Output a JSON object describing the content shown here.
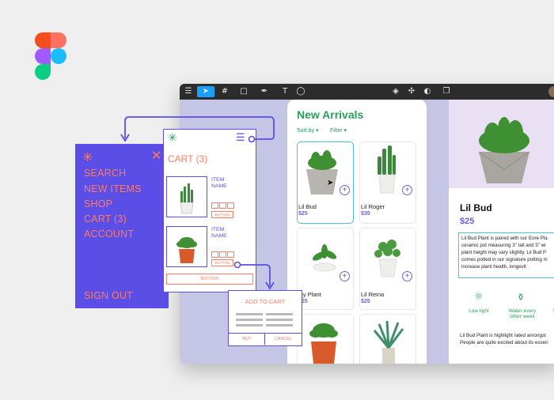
{
  "colors": {
    "background": "#efefef",
    "toolbar": "#2c2c2c",
    "toolbar_active": "#18a0fb",
    "prototype_purple": "#5b4ee6",
    "prototype_orange": "#ff7b62",
    "brand_green": "#27a05a",
    "price_purple": "#6b60d8",
    "selection_cyan": "#4fc0d8",
    "figma_logo": [
      "#f24e1e",
      "#ff7262",
      "#a259ff",
      "#1abcfe",
      "#0acf83"
    ]
  },
  "toolbar": {
    "icons": [
      "menu-icon",
      "move-tool-icon",
      "frame-tool-icon",
      "rectangle-tool-icon",
      "pen-tool-icon",
      "text-tool-icon",
      "comment-icon",
      "component-icon",
      "mask-icon",
      "contrast-icon",
      "layers-icon",
      "avatar"
    ]
  },
  "new_arrivals": {
    "title": "New Arrivals",
    "sort_label": "Sort by",
    "filter_label": "Filter",
    "products": [
      {
        "name": "Lil Bud",
        "price": "$25"
      },
      {
        "name": "Lil Roger",
        "price": "$35"
      },
      {
        "name": "iny Plant",
        "price": "$25"
      },
      {
        "name": "Lil Reina",
        "price": "$25"
      },
      {
        "name": "",
        "price": ""
      },
      {
        "name": "",
        "price": ""
      }
    ]
  },
  "detail": {
    "name": "Lil Bud",
    "price": "$25",
    "description": "Lil Bud Plant is paired with our Eore Pla\nceramic pot measuring 3\" tall and 5\" wi\nplant height may vary slightly. Lil Bud P\ncomes potted in our signature potting m\nincrease plant health, longevit",
    "features": [
      "Low light",
      "Water every\nother week",
      "Sr"
    ],
    "more": "Lil Bud Plant is highlight rated amongst\nPeople are quite excited about its essen"
  },
  "menu": {
    "items": [
      "SEARCH",
      "NEW ITEMS",
      "SHOP",
      "CART (3)",
      "ACCOUNT"
    ],
    "sign_out": "SIGN OUT"
  },
  "cart": {
    "title": "CART (3)",
    "item_label": "ITEM\nNAME",
    "item_button": "BUTTON",
    "main_button": "BUTTON"
  },
  "dialog": {
    "title": "ADD TO CART",
    "buy": "BUY",
    "cancel": "CANCEL"
  }
}
